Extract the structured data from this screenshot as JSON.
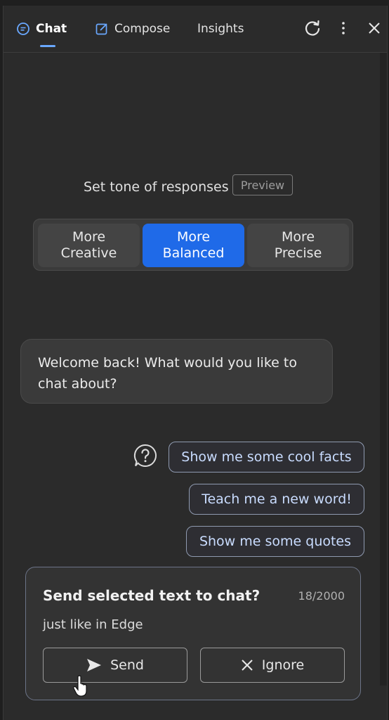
{
  "tabs": [
    {
      "label": "Chat",
      "icon": "chat-icon",
      "active": true
    },
    {
      "label": "Compose",
      "icon": "compose-icon",
      "active": false
    },
    {
      "label": "Insights",
      "icon": "",
      "active": false
    }
  ],
  "toolbar": {
    "refresh_icon": "refresh-icon",
    "more_icon": "more-vertical-icon",
    "close_icon": "close-icon"
  },
  "tone": {
    "label": "Set tone of responses",
    "badge": "Preview",
    "options": [
      {
        "line1": "More",
        "line2": "Creative",
        "selected": false
      },
      {
        "line1": "More",
        "line2": "Balanced",
        "selected": true
      },
      {
        "line1": "More",
        "line2": "Precise",
        "selected": false
      }
    ]
  },
  "chat": {
    "welcome_line1": "Welcome back! What would you like to",
    "welcome_line2": "chat about?"
  },
  "suggestions": [
    "Show me some cool facts",
    "Teach me a new word!",
    "Show me some quotes"
  ],
  "send_prompt": {
    "title": "Send selected text to chat?",
    "count": "18/2000",
    "selected_text": "just like in Edge",
    "send_label": "Send",
    "ignore_label": "Ignore"
  },
  "colors": {
    "accent": "#1f6ae8",
    "suggestion_text": "#c9dcff",
    "tab_underline": "#6aa8ff"
  }
}
